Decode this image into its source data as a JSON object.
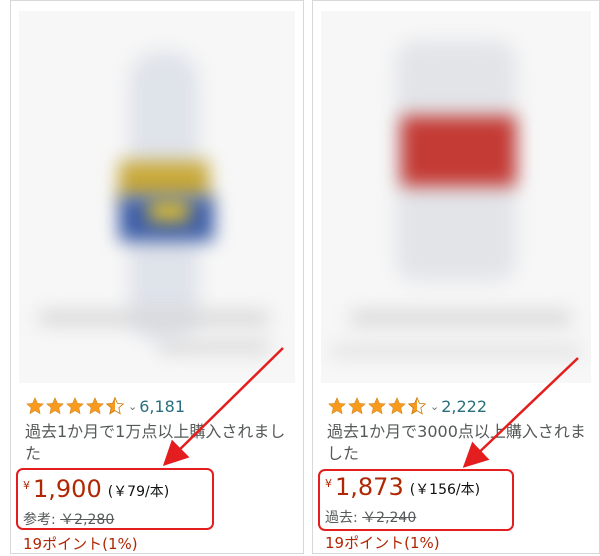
{
  "products": [
    {
      "rating": 4.5,
      "review_count": "6,181",
      "bought_text": "過去1か月で1万点以上購入されました",
      "currency": "¥",
      "price": "1,900",
      "unit_price": "(￥79/本)",
      "ref_label": "参考:",
      "ref_price": "￥2,280",
      "points": "19ポイント(1%)"
    },
    {
      "rating": 4.5,
      "review_count": "2,222",
      "bought_text": "過去1か月で3000点以上購入されました",
      "currency": "¥",
      "price": "1,873",
      "unit_price": "(￥156/本)",
      "ref_label": "過去:",
      "ref_price": "￥2,240",
      "points": "19ポイント(1%)"
    }
  ],
  "colors": {
    "star": "#f79a1e",
    "price": "#b12704",
    "link": "#2a6f7d",
    "highlight": "#e41e1e"
  },
  "icons": {
    "star": "star-icon",
    "chevron": "chevron-down-icon",
    "arrow": "annotation-arrow"
  }
}
